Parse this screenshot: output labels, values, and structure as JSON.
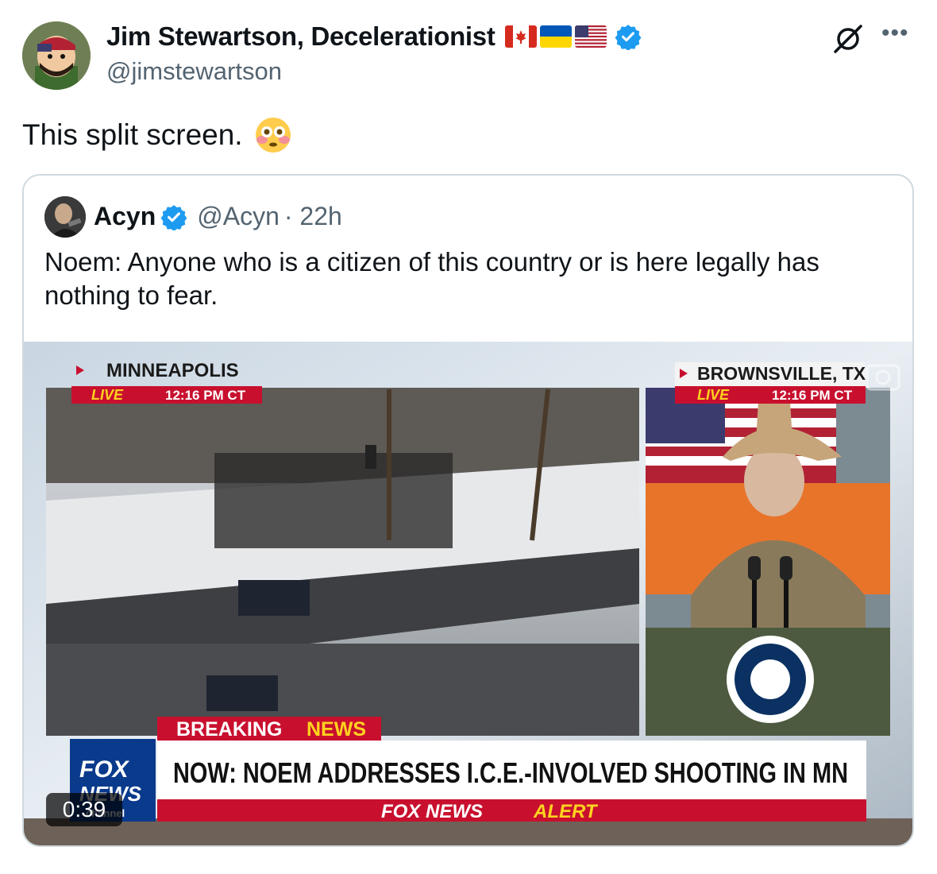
{
  "tweet": {
    "author_name": "Jim Stewartson, Decelerationist",
    "author_handle": "@jimstewartson",
    "flags": [
      "canada-flag",
      "ukraine-flag",
      "usa-flag"
    ],
    "verified": true,
    "text": "This split screen.",
    "emoji": "flushed-face"
  },
  "quoted": {
    "author_name": "Acyn",
    "author_handle": "@Acyn",
    "time": "· 22h",
    "verified": true,
    "text": "Noem: Anyone who is a citizen of this country or is here legally has nothing to fear."
  },
  "video": {
    "duration": "0:39",
    "left_location": "MINNEAPOLIS",
    "right_location": "BROWNSVILLE, TX",
    "live_label": "LIVE",
    "time_label": "12:16 PM CT",
    "breaking": "BREAKING",
    "news": "NEWS",
    "headline": "NOW: NOEM ADDRESSES I.C.E.-INVOLVED SHOOTING IN MN",
    "alert_fox": "FOX NEWS",
    "alert_word": "ALERT",
    "logo_fox": "FOX",
    "logo_news": "NEWS",
    "logo_channel": "channel"
  },
  "colors": {
    "verified_blue": "#1d9bf0",
    "text_primary": "#0f1419",
    "text_secondary": "#536471",
    "fox_red": "#c8102e",
    "fox_yellow": "#ffd21f"
  }
}
